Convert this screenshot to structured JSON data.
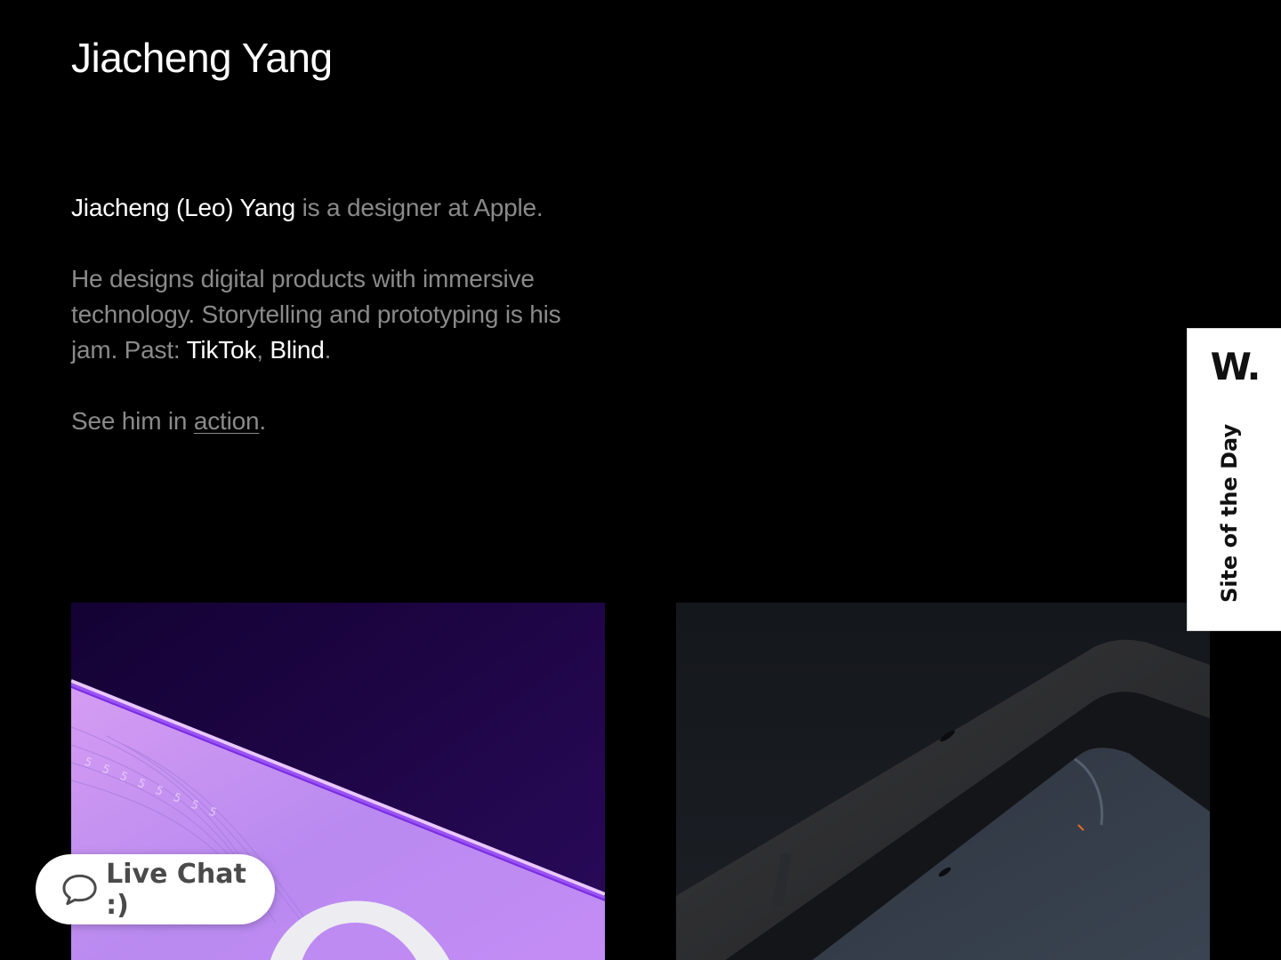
{
  "header": {
    "title": "Jiacheng Yang"
  },
  "bio": {
    "name": "Jiacheng (Leo) Yang",
    "intro_rest": " is a designer at Apple.",
    "p2_text": "He designs digital products with immersive technology. Storytelling and prototyping is his jam. Past: ",
    "past_1": "TikTok",
    "separator": ", ",
    "past_2": "Blind",
    "period": ".",
    "p3_text": "See him in ",
    "action_link": "action",
    "p3_end": "."
  },
  "projects": [
    {
      "label": "project-card-purple",
      "accent": "#b07cff"
    },
    {
      "label": "project-card-device",
      "accent": "#2b2f35"
    }
  ],
  "awwwards": {
    "logo": "W.",
    "text": "Site of the Day"
  },
  "live_chat": {
    "label": "Live Chat :)",
    "icon": "speech-bubble-icon"
  },
  "colors": {
    "background": "#000000",
    "text_primary": "#ffffff",
    "text_secondary": "#8a8a8a"
  }
}
